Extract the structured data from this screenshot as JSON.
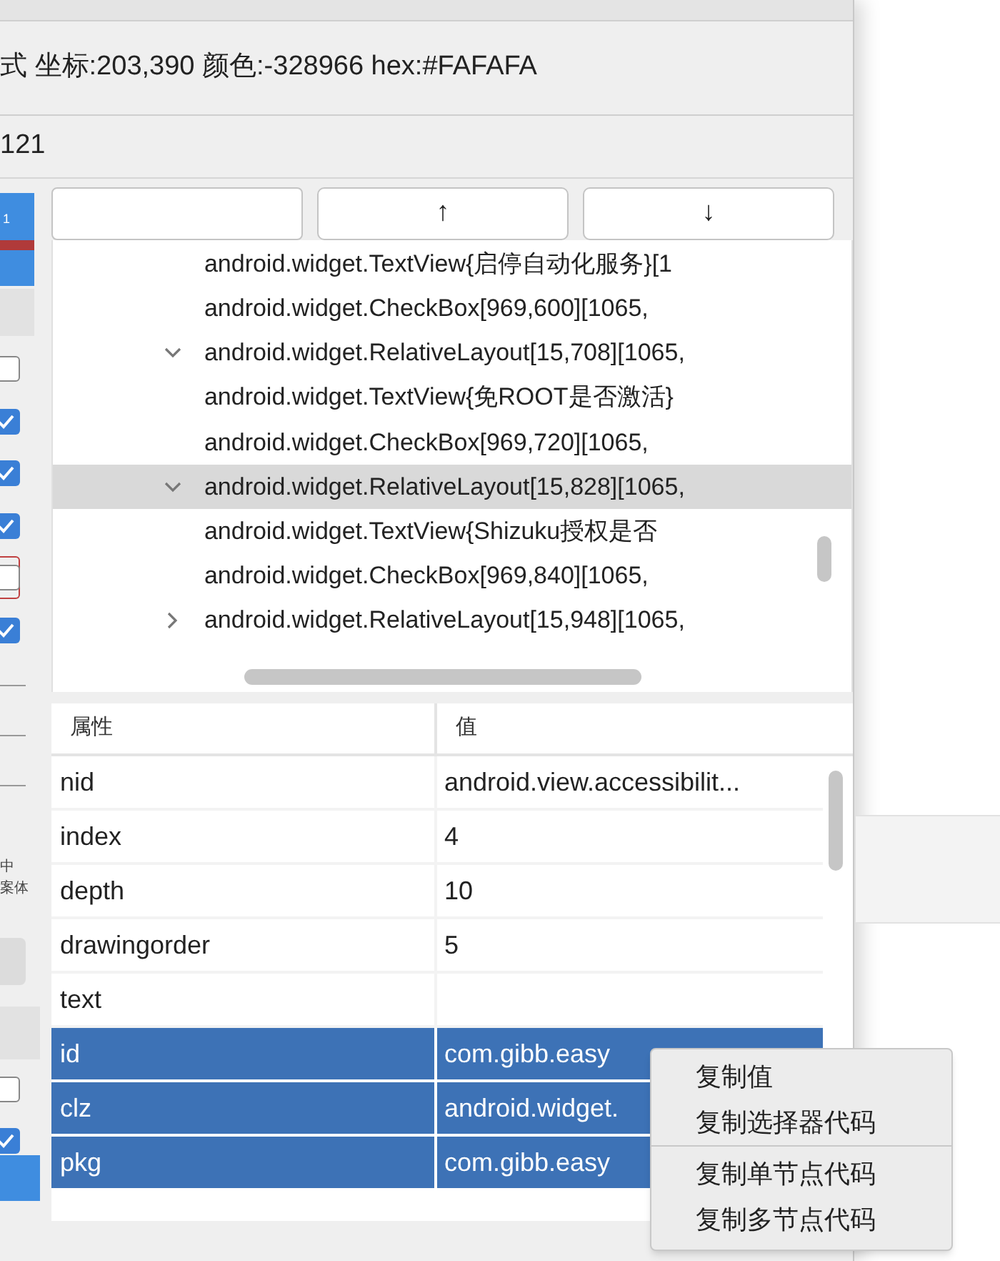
{
  "status_line": "式 坐标:203,390 颜色:-328966 hex:#FAFAFA",
  "second_line": "121",
  "left_strip": {
    "badge": "1",
    "checkboxes": [
      {
        "checked": false,
        "flagged": false
      },
      {
        "checked": true,
        "flagged": false
      },
      {
        "checked": true,
        "flagged": false
      },
      {
        "checked": true,
        "flagged": false
      },
      {
        "checked": false,
        "flagged": true
      },
      {
        "checked": true,
        "flagged": false
      }
    ],
    "labels": [
      "中",
      "案体"
    ],
    "lower_checkboxes": [
      {
        "checked": false
      },
      {
        "checked": true
      }
    ]
  },
  "nav_buttons": [
    "↑",
    "↓"
  ],
  "tree": {
    "continued_children": [
      {
        "label": "android.widget.TextView{启停自动化服务}[1",
        "selected": false
      },
      {
        "label": "android.widget.CheckBox[969,600][1065,",
        "selected": false
      }
    ],
    "nodes": [
      {
        "label": "android.widget.RelativeLayout[15,708][1065,",
        "expanded": true,
        "selected": false,
        "children": [
          {
            "label": "android.widget.TextView{免ROOT是否激活}",
            "selected": false
          },
          {
            "label": "android.widget.CheckBox[969,720][1065,",
            "selected": false
          }
        ]
      },
      {
        "label": "android.widget.RelativeLayout[15,828][1065,",
        "expanded": true,
        "selected": true,
        "children": [
          {
            "label": "android.widget.TextView{Shizuku授权是否",
            "selected": false
          },
          {
            "label": "android.widget.CheckBox[969,840][1065,",
            "selected": false
          }
        ]
      },
      {
        "label": "android.widget.RelativeLayout[15,948][1065,",
        "expanded": false,
        "selected": false
      }
    ]
  },
  "table": {
    "columns": [
      "属性",
      "值"
    ],
    "rows": [
      {
        "name": "nid",
        "value": "android.view.accessibilit...",
        "selected": false
      },
      {
        "name": "index",
        "value": "4",
        "selected": false
      },
      {
        "name": "depth",
        "value": "10",
        "selected": false
      },
      {
        "name": "drawingorder",
        "value": "5",
        "selected": false
      },
      {
        "name": "text",
        "selected": false
      },
      {
        "name": "id",
        "value": "com.gibb.easy",
        "selected": true
      },
      {
        "name": "clz",
        "value": "android.widget.",
        "selected": true
      },
      {
        "name": "pkg",
        "value": "com.gibb.easy",
        "selected": true
      }
    ]
  },
  "context_menu": [
    {
      "label": "复制值",
      "separator_after": false
    },
    {
      "label": "复制选择器代码",
      "separator_after": true
    },
    {
      "label": "复制单节点代码",
      "separator_after": false
    },
    {
      "label": "复制多节点代码",
      "separator_after": false
    }
  ]
}
